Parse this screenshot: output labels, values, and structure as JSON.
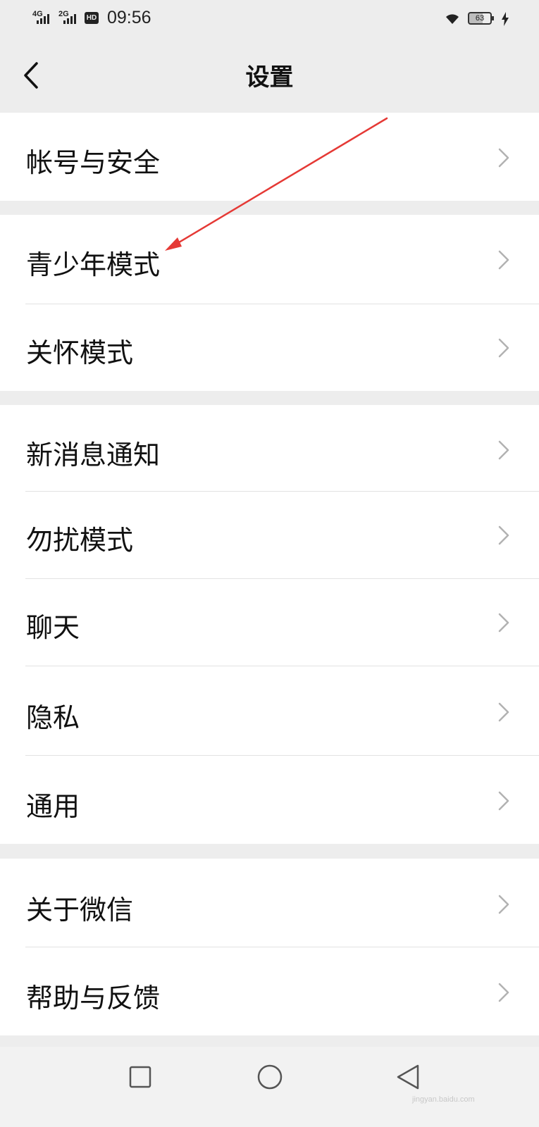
{
  "status_bar": {
    "network_1": "4G",
    "network_2": "2G",
    "hd_badge": "HD",
    "time": "09:56",
    "battery": "63",
    "battery_level_percent": 63,
    "icons": [
      "signal-icon",
      "wifi-icon",
      "battery-icon",
      "charging-icon"
    ]
  },
  "header": {
    "title": "设置",
    "back_icon": "chevron-left-icon"
  },
  "groups": [
    {
      "items": [
        {
          "label": "帐号与安全"
        }
      ]
    },
    {
      "items": [
        {
          "label": "青少年模式"
        },
        {
          "label": "关怀模式"
        }
      ]
    },
    {
      "items": [
        {
          "label": "新消息通知"
        },
        {
          "label": "勿扰模式"
        },
        {
          "label": "聊天"
        },
        {
          "label": "隐私"
        },
        {
          "label": "通用"
        }
      ]
    },
    {
      "items": [
        {
          "label": "关于微信"
        },
        {
          "label": "帮助与反馈"
        }
      ]
    }
  ],
  "system_nav": {
    "buttons": [
      "recents-square-icon",
      "home-circle-icon",
      "back-triangle-icon"
    ]
  },
  "watermark": "jingyan.baidu.com",
  "colors": {
    "background": "#ededed",
    "card": "#ffffff",
    "annotation_arrow": "#e53935",
    "chevron": "#b2b2b2"
  }
}
